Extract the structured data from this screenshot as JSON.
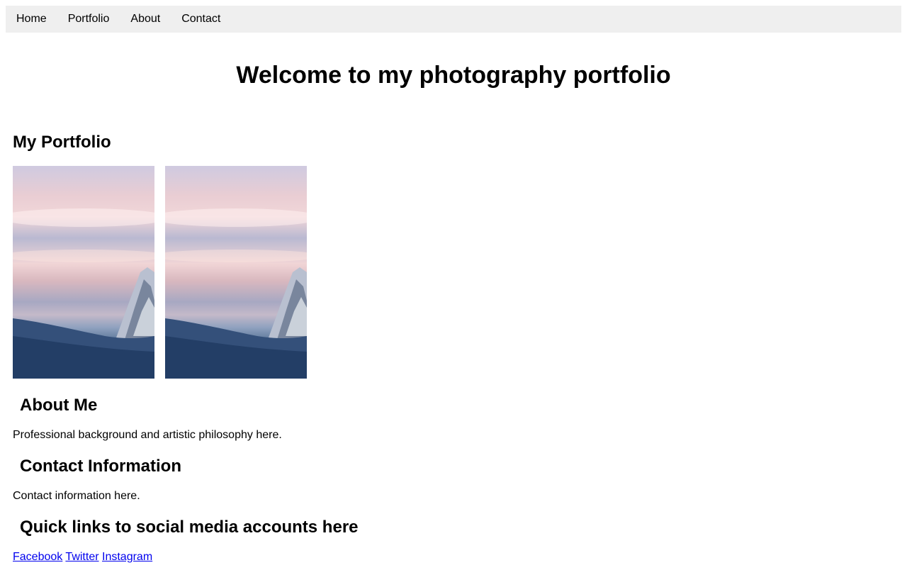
{
  "nav": {
    "items": [
      {
        "label": "Home"
      },
      {
        "label": "Portfolio"
      },
      {
        "label": "About"
      },
      {
        "label": "Contact"
      }
    ]
  },
  "hero": {
    "title": "Welcome to my photography portfolio"
  },
  "portfolio": {
    "title": "My Portfolio",
    "photos": [
      {
        "subject": "snowy-mountain-sunset-photo"
      },
      {
        "subject": "snowy-mountain-sunset-photo"
      }
    ]
  },
  "about": {
    "title": "About Me",
    "text": "Professional background and artistic philosophy here."
  },
  "contact": {
    "title": "Contact Information",
    "text": "Contact information here."
  },
  "social": {
    "title": "Quick links to social media accounts here",
    "links": [
      {
        "label": "Facebook"
      },
      {
        "label": "Twitter"
      },
      {
        "label": "Instagram"
      }
    ]
  },
  "colors": {
    "nav_background": "#efefef",
    "link": "#0000ee",
    "text": "#000000"
  }
}
